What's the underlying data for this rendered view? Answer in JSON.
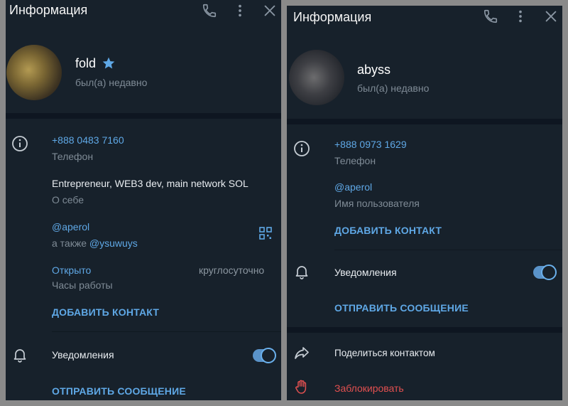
{
  "colors": {
    "panel_bg": "#17212b",
    "separator": "#0e1621",
    "accent": "#5fa8e6",
    "muted": "#7f8b96",
    "danger": "#e25050"
  },
  "left": {
    "header": {
      "title": "Информация"
    },
    "profile": {
      "name": "fold",
      "status": "был(а) недавно"
    },
    "phone": {
      "value": "+888 0483 7160",
      "label": "Телефон"
    },
    "bio": {
      "value": "Entrepreneur, WEB3 dev, main network SOL",
      "label": "О себе"
    },
    "username": {
      "value": "@aperol",
      "also_prefix": "а также",
      "also_value": "@ysuwuys"
    },
    "hours": {
      "status": "Открыто",
      "detail": "круглосуточно",
      "label": "Часы работы"
    },
    "add_contact": "ДОБАВИТЬ КОНТАКТ",
    "notifications": {
      "label": "Уведомления",
      "enabled": true
    },
    "send_message": "ОТПРАВИТЬ СООБЩЕНИЕ"
  },
  "right": {
    "header": {
      "title": "Информация"
    },
    "profile": {
      "name": "abyss",
      "status": "был(а) недавно"
    },
    "phone": {
      "value": "+888 0973 1629",
      "label": "Телефон"
    },
    "username": {
      "value": "@aperol",
      "label": "Имя пользователя"
    },
    "add_contact": "ДОБАВИТЬ КОНТАКТ",
    "notifications": {
      "label": "Уведомления",
      "enabled": true
    },
    "send_message": "ОТПРАВИТЬ СООБЩЕНИЕ",
    "share_contact": "Поделиться контактом",
    "block": "Заблокировать"
  }
}
